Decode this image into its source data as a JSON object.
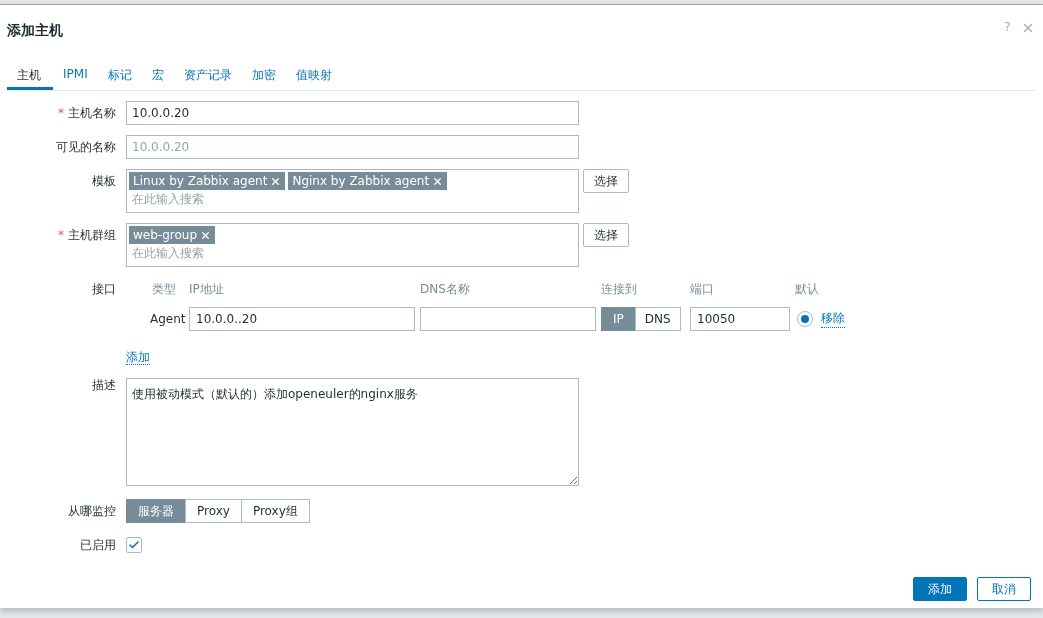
{
  "dialog": {
    "title": "添加主机",
    "help_glyph": "?"
  },
  "tabs": [
    {
      "label": "主机",
      "selected": true
    },
    {
      "label": "IPMI",
      "selected": false
    },
    {
      "label": "标记",
      "selected": false
    },
    {
      "label": "宏",
      "selected": false
    },
    {
      "label": "资产记录",
      "selected": false
    },
    {
      "label": "加密",
      "selected": false
    },
    {
      "label": "值映射",
      "selected": false
    }
  ],
  "host_name": {
    "label": "主机名称",
    "required_mark": "*",
    "value": "10.0.0.20"
  },
  "visible_name": {
    "label": "可见的名称",
    "placeholder": "10.0.0.20"
  },
  "templates": {
    "label": "模板",
    "tags": [
      "Linux by Zabbix agent",
      "Nginx by Zabbix agent"
    ],
    "placeholder": "在此输入搜索",
    "select_button": "选择"
  },
  "host_groups": {
    "label": "主机群组",
    "required_mark": "*",
    "tags": [
      "web-group"
    ],
    "placeholder": "在此输入搜索",
    "select_button": "选择"
  },
  "interfaces": {
    "label": "接口",
    "columns": [
      "类型",
      "IP地址",
      "DNS名称",
      "连接到",
      "端口",
      "默认"
    ],
    "rows": [
      {
        "type": "Agent",
        "ip": "10.0.0..20",
        "connect_to": [
          {
            "label": "IP",
            "selected": true
          },
          {
            "label": "DNS",
            "selected": false
          }
        ],
        "port": "10050",
        "default": true,
        "remove": "移除"
      }
    ],
    "add_link": "添加"
  },
  "description": {
    "label": "描述",
    "value": "使用被动模式（默认的）添加openeuler的nginx服务"
  },
  "monitored_by": {
    "label": "从哪监控",
    "options": [
      {
        "label": "服务器",
        "selected": true
      },
      {
        "label": "Proxy",
        "selected": false
      },
      {
        "label": "Proxy组",
        "selected": false
      }
    ]
  },
  "enabled": {
    "label": "已启用",
    "checked": true
  },
  "buttons": [
    {
      "label": "添加",
      "kind": "primary"
    },
    {
      "label": "取消",
      "kind": "secondary"
    }
  ]
}
